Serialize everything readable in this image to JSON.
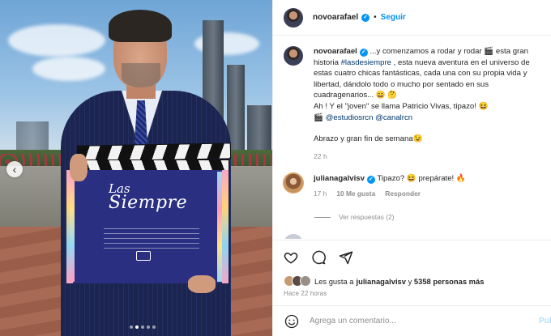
{
  "post": {
    "username": "novoarafael",
    "verified_badge": "✓",
    "separator": "•",
    "follow_label": "Seguir"
  },
  "photo": {
    "clapper_title_line1": "Las ",
    "clapper_title_line2": "Siempre",
    "prev_icon": "‹",
    "carousel_dots": 5,
    "carousel_active_index": 1
  },
  "caption": {
    "username": "novoarafael",
    "text_1": " ...y comenzamos a rodar y rodar 🎬 esta gran historia ",
    "hashtag": "#lasdesiempre",
    "text_2": " , esta nueva aventura en el universo de estas cuatro chicas fantásticas, cada una con su propia vida y libertad, dándolo todo o mucho por sentado en sus cuadragenarios... 😄 🤔",
    "line_2": "Ah ! Y el \"joven\" se llama Patricio Vivas, tipazo! 😆",
    "line_3_icon": "🎬",
    "mention_1": "@estudiosrcn",
    "mention_2": "@canalrcn",
    "line_4": "Abrazo y gran fin de semana😉",
    "time": "22 h"
  },
  "reply": {
    "username": "julianagalvisv",
    "verified_badge": "✓",
    "text": " Tipazo? 😆 prepárate! 🔥",
    "time": "17 h",
    "likes": "10 Me gusta",
    "reply_label": "Responder",
    "see_replies": "Ver respuestas (2)"
  },
  "partial_comment": {
    "text": "··· ··· ··· ····   ·· ··  ··· ···"
  },
  "likes": {
    "prefix": "Les gusta a ",
    "user": "julianagalvisv",
    "middle": " y ",
    "count": "5358 personas más"
  },
  "timestamp": "Hace 22 horas",
  "add_comment": {
    "placeholder": "Agrega un comentario...",
    "publish_label": "Publicar"
  },
  "colors": {
    "accent": "#0095f6",
    "link": "#00376b",
    "muted": "#8e8e8e",
    "text": "#262626"
  },
  "icons": [
    "heart-icon",
    "comment-icon",
    "share-icon",
    "emoji-icon",
    "verified-icon",
    "chevron-left-icon"
  ]
}
